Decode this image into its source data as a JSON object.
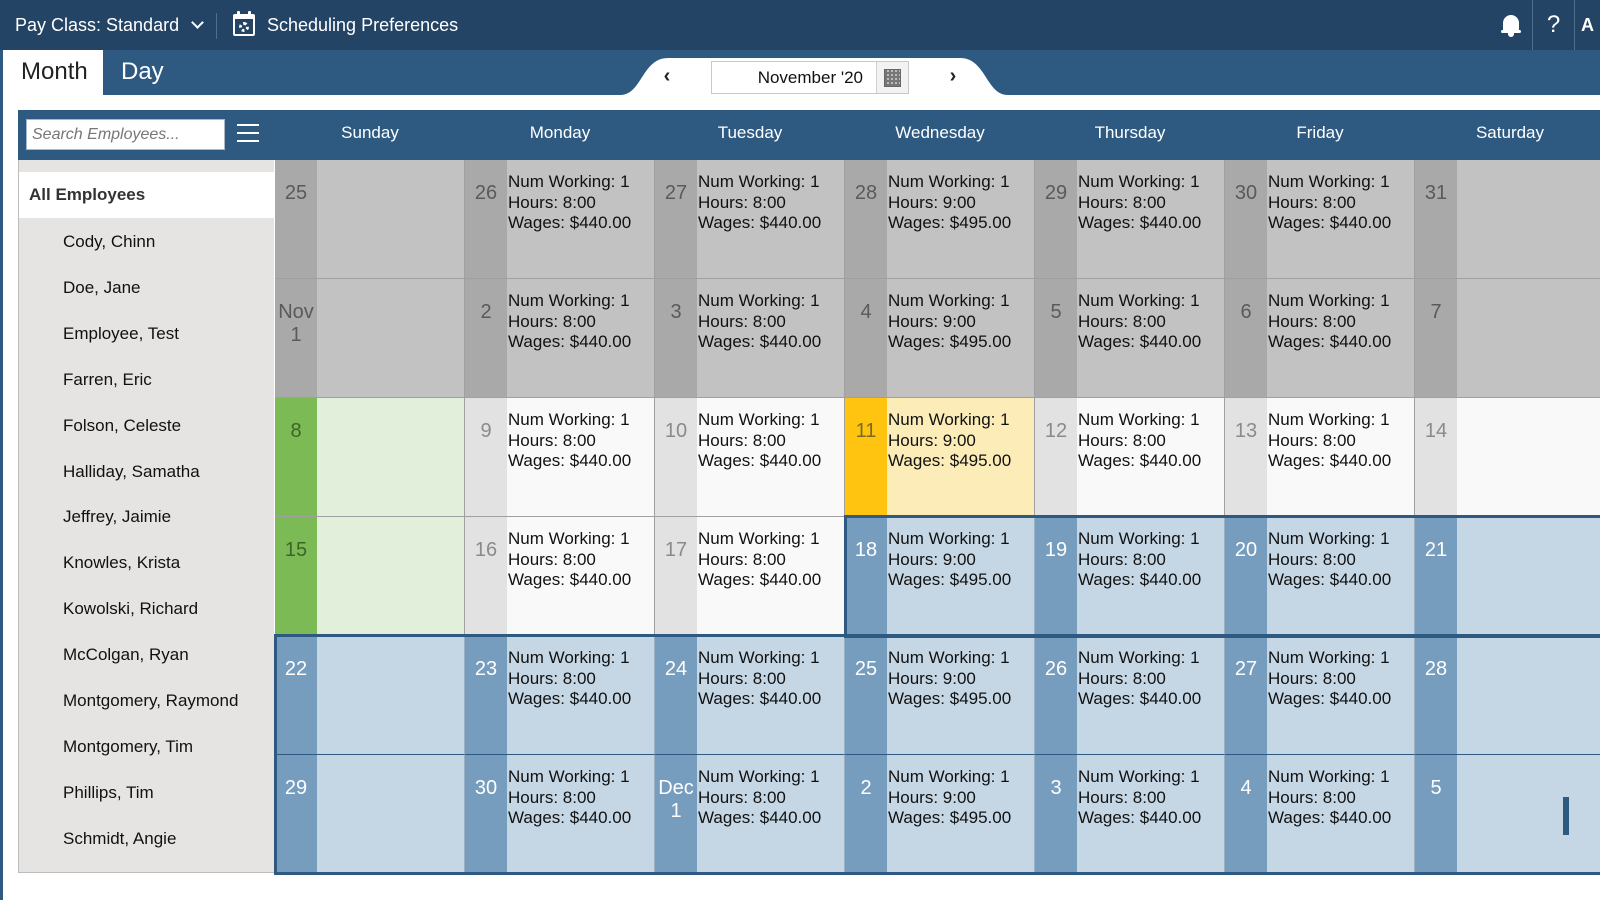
{
  "topbar": {
    "pay_class_label": "Pay Class: Standard",
    "scheduling_preferences_label": "Scheduling Preferences",
    "help_label": "?",
    "user_label": "A"
  },
  "tabs": [
    {
      "label": "Month",
      "active": true
    },
    {
      "label": "Day",
      "active": false
    }
  ],
  "month_nav": {
    "prev_label": "‹",
    "next_label": "›",
    "current_month": "November '20"
  },
  "search": {
    "placeholder": "Search Employees...",
    "value": ""
  },
  "day_names": [
    "Sunday",
    "Monday",
    "Tuesday",
    "Wednesday",
    "Thursday",
    "Friday",
    "Saturday"
  ],
  "sidebar": {
    "all_label": "All Employees",
    "employees": [
      "Cody, Chinn",
      "Doe, Jane",
      "Employee, Test",
      "Farren, Eric",
      "Folson, Celeste",
      "Halliday, Samatha",
      "Jeffrey, Jaimie",
      "Knowles, Krista",
      "Kowolski, Richard",
      "McColgan, Ryan",
      "Montgomery, Raymond",
      "Montgomery, Tim",
      "Phillips, Tim",
      "Schmidt, Angie"
    ]
  },
  "colors": {
    "topbar": "#244466",
    "primary": "#2e5a82",
    "today": "#fec40f",
    "weekend_highlight": "#7cba55",
    "selected_week": "#769dbd"
  },
  "labels": {
    "num_working": "Num Working",
    "hours": "Hours",
    "wages": "Wages"
  },
  "weeks": [
    [
      {
        "date": "25",
        "state": "past"
      },
      {
        "date": "26",
        "state": "past",
        "num_working": "1",
        "hours": "8:00",
        "wages": "$440.00"
      },
      {
        "date": "27",
        "state": "past",
        "num_working": "1",
        "hours": "8:00",
        "wages": "$440.00"
      },
      {
        "date": "28",
        "state": "past",
        "num_working": "1",
        "hours": "9:00",
        "wages": "$495.00"
      },
      {
        "date": "29",
        "state": "past",
        "num_working": "1",
        "hours": "8:00",
        "wages": "$440.00"
      },
      {
        "date": "30",
        "state": "past",
        "num_working": "1",
        "hours": "8:00",
        "wages": "$440.00"
      },
      {
        "date": "31",
        "state": "past"
      }
    ],
    [
      {
        "date": "Nov\n1",
        "state": "past"
      },
      {
        "date": "2",
        "state": "past",
        "num_working": "1",
        "hours": "8:00",
        "wages": "$440.00"
      },
      {
        "date": "3",
        "state": "past",
        "num_working": "1",
        "hours": "8:00",
        "wages": "$440.00"
      },
      {
        "date": "4",
        "state": "past",
        "num_working": "1",
        "hours": "9:00",
        "wages": "$495.00"
      },
      {
        "date": "5",
        "state": "past",
        "num_working": "1",
        "hours": "8:00",
        "wages": "$440.00"
      },
      {
        "date": "6",
        "state": "past",
        "num_working": "1",
        "hours": "8:00",
        "wages": "$440.00"
      },
      {
        "date": "7",
        "state": "past"
      }
    ],
    [
      {
        "date": "8",
        "state": "weekend-green"
      },
      {
        "date": "9",
        "state": "cur",
        "num_working": "1",
        "hours": "8:00",
        "wages": "$440.00"
      },
      {
        "date": "10",
        "state": "cur",
        "num_working": "1",
        "hours": "8:00",
        "wages": "$440.00"
      },
      {
        "date": "11",
        "state": "today",
        "num_working": "1",
        "hours": "9:00",
        "wages": "$495.00"
      },
      {
        "date": "12",
        "state": "cur",
        "num_working": "1",
        "hours": "8:00",
        "wages": "$440.00"
      },
      {
        "date": "13",
        "state": "cur",
        "num_working": "1",
        "hours": "8:00",
        "wages": "$440.00"
      },
      {
        "date": "14",
        "state": "cur"
      }
    ],
    [
      {
        "date": "15",
        "state": "weekend-green"
      },
      {
        "date": "16",
        "state": "cur",
        "num_working": "1",
        "hours": "8:00",
        "wages": "$440.00"
      },
      {
        "date": "17",
        "state": "cur",
        "num_working": "1",
        "hours": "8:00",
        "wages": "$440.00"
      },
      {
        "date": "18",
        "state": "sel",
        "num_working": "1",
        "hours": "9:00",
        "wages": "$495.00"
      },
      {
        "date": "19",
        "state": "sel",
        "num_working": "1",
        "hours": "8:00",
        "wages": "$440.00"
      },
      {
        "date": "20",
        "state": "sel",
        "num_working": "1",
        "hours": "8:00",
        "wages": "$440.00"
      },
      {
        "date": "21",
        "state": "sel"
      }
    ],
    [
      {
        "date": "22",
        "state": "sel"
      },
      {
        "date": "23",
        "state": "sel",
        "num_working": "1",
        "hours": "8:00",
        "wages": "$440.00"
      },
      {
        "date": "24",
        "state": "sel",
        "num_working": "1",
        "hours": "8:00",
        "wages": "$440.00"
      },
      {
        "date": "25",
        "state": "sel",
        "num_working": "1",
        "hours": "9:00",
        "wages": "$495.00"
      },
      {
        "date": "26",
        "state": "sel",
        "num_working": "1",
        "hours": "8:00",
        "wages": "$440.00"
      },
      {
        "date": "27",
        "state": "sel",
        "num_working": "1",
        "hours": "8:00",
        "wages": "$440.00"
      },
      {
        "date": "28",
        "state": "sel"
      }
    ],
    [
      {
        "date": "29",
        "state": "sel"
      },
      {
        "date": "30",
        "state": "sel",
        "num_working": "1",
        "hours": "8:00",
        "wages": "$440.00"
      },
      {
        "date": "Dec\n1",
        "state": "sel",
        "num_working": "1",
        "hours": "8:00",
        "wages": "$440.00"
      },
      {
        "date": "2",
        "state": "sel",
        "num_working": "1",
        "hours": "9:00",
        "wages": "$495.00"
      },
      {
        "date": "3",
        "state": "sel",
        "num_working": "1",
        "hours": "8:00",
        "wages": "$440.00"
      },
      {
        "date": "4",
        "state": "sel",
        "num_working": "1",
        "hours": "8:00",
        "wages": "$440.00"
      },
      {
        "date": "5",
        "state": "sel"
      }
    ]
  ]
}
